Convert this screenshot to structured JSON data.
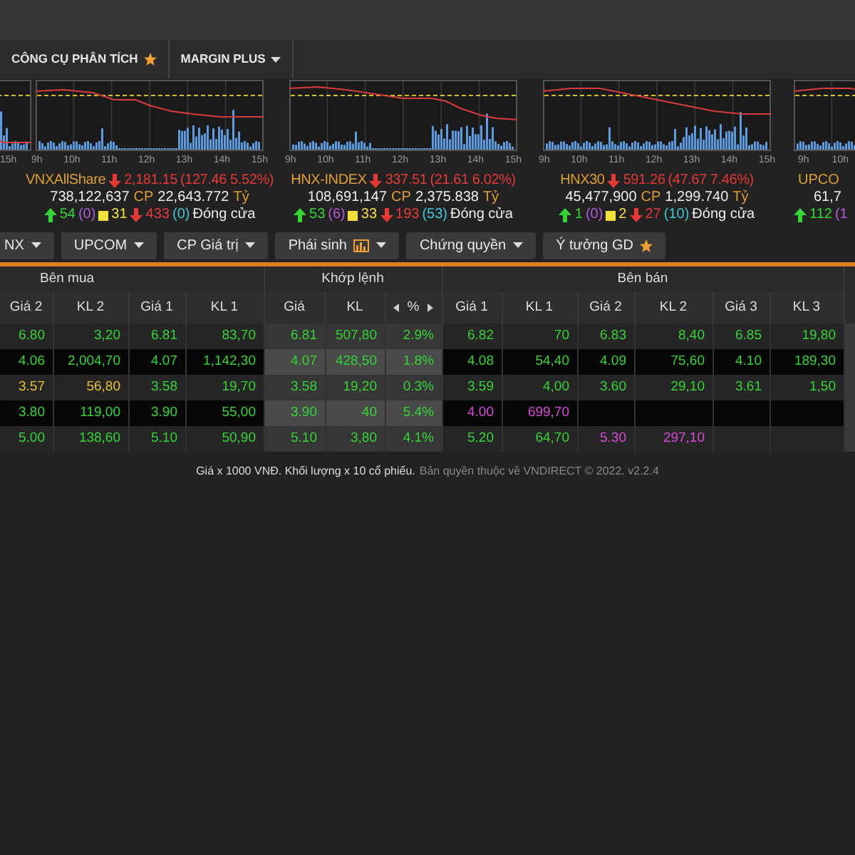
{
  "menu": [
    {
      "label": "CÔNG CỤ PHÂN TÍCH"
    },
    {
      "label": "MARGIN PLUS"
    }
  ],
  "indices": [
    {
      "kind": "partial-left",
      "x_labels": [
        "15h"
      ]
    },
    {
      "kind": "full",
      "x_labels": [
        "9h",
        "10h",
        "11h",
        "12h",
        "13h",
        "14h",
        "15h"
      ],
      "name": "VNXAllShare",
      "value": "2,181.15",
      "change": "(127.46 5.52%)",
      "volume": "738,122,637",
      "volume_unit": "CP",
      "turnover": "22,643.772",
      "turnover_unit": "Tỷ",
      "up": "54",
      "ceiling": "(0)",
      "flat": "31",
      "down": "433",
      "floor": "(0)",
      "status": "Đóng cửa"
    },
    {
      "kind": "full",
      "x_labels": [
        "9h",
        "10h",
        "11h",
        "12h",
        "13h",
        "14h",
        "15h"
      ],
      "name": "HNX-INDEX",
      "value": "337.51",
      "change": "(21.61 6.02%)",
      "volume": "108,691,147",
      "volume_unit": "CP",
      "turnover": "2,375.838",
      "turnover_unit": "Tỷ",
      "up": "53",
      "ceiling": "(6)",
      "flat": "33",
      "down": "193",
      "floor": "(53)",
      "status": "Đóng cửa"
    },
    {
      "kind": "full",
      "x_labels": [
        "9h",
        "10h",
        "11h",
        "12h",
        "13h",
        "14h",
        "15h"
      ],
      "name": "HNX30",
      "value": "591.26",
      "change": "(47.67 7.46%)",
      "volume": "45,477,900",
      "volume_unit": "CP",
      "turnover": "1,299.740",
      "turnover_unit": "Tỷ",
      "up": "1",
      "ceiling": "(0)",
      "flat": "2",
      "down": "27",
      "floor": "(10)",
      "status": "Đóng cửa"
    },
    {
      "kind": "partial-right",
      "x_labels": [
        "9h",
        "10h"
      ],
      "name": "UPCO",
      "volume": "61,7",
      "up": "112",
      "ceiling": "(1"
    }
  ],
  "tabs": [
    {
      "label": "NX"
    },
    {
      "label": "UPCOM"
    },
    {
      "label": "CP Giá trị"
    },
    {
      "label": "Phái sinh"
    },
    {
      "label": "Chứng quyền"
    },
    {
      "label": "Ý tưởng GD"
    }
  ],
  "table": {
    "groups": [
      {
        "label": "Bên mua",
        "columns": [
          "Giá 2",
          "KL 2",
          "Giá 1",
          "KL 1"
        ]
      },
      {
        "label": "Khớp lệnh",
        "columns": [
          "Giá",
          "KL",
          "%"
        ]
      },
      {
        "label": "Bên bán",
        "columns": [
          "Giá 1",
          "KL 1",
          "Giá 2",
          "KL 2",
          "Giá 3",
          "KL 3"
        ]
      }
    ],
    "rows": [
      {
        "cells": [
          {
            "text": "6.80",
            "color": "#33d633"
          },
          {
            "text": "3,20",
            "color": "#33d633"
          },
          {
            "text": "6.81",
            "color": "#33d633"
          },
          {
            "text": "83,70",
            "color": "#33d633"
          },
          {
            "text": "6.81",
            "color": "#33d633"
          },
          {
            "text": "507,80",
            "color": "#33d633"
          },
          {
            "text": "2.9%",
            "color": "#33d633"
          },
          {
            "text": "6.82",
            "color": "#33d633"
          },
          {
            "text": "70",
            "color": "#33d633"
          },
          {
            "text": "6.83",
            "color": "#33d633"
          },
          {
            "text": "8,40",
            "color": "#33d633"
          },
          {
            "text": "6.85",
            "color": "#33d633"
          },
          {
            "text": "19,80",
            "color": "#33d633"
          }
        ]
      },
      {
        "cells": [
          {
            "text": "4.06",
            "color": "#33d633"
          },
          {
            "text": "2,004,70",
            "color": "#33d633"
          },
          {
            "text": "4.07",
            "color": "#33d633"
          },
          {
            "text": "1,142,30",
            "color": "#33d633"
          },
          {
            "text": "4.07",
            "color": "#33d633"
          },
          {
            "text": "428,50",
            "color": "#33d633"
          },
          {
            "text": "1.8%",
            "color": "#33d633"
          },
          {
            "text": "4.08",
            "color": "#33d633"
          },
          {
            "text": "54,40",
            "color": "#33d633"
          },
          {
            "text": "4.09",
            "color": "#33d633"
          },
          {
            "text": "75,60",
            "color": "#33d633"
          },
          {
            "text": "4.10",
            "color": "#33d633"
          },
          {
            "text": "189,30",
            "color": "#33d633"
          }
        ]
      },
      {
        "cells": [
          {
            "text": "3.57",
            "color": "#e8c02a"
          },
          {
            "text": "56,80",
            "color": "#e8c02a"
          },
          {
            "text": "3.58",
            "color": "#33d633"
          },
          {
            "text": "19,70",
            "color": "#33d633"
          },
          {
            "text": "3.58",
            "color": "#33d633"
          },
          {
            "text": "19,20",
            "color": "#33d633"
          },
          {
            "text": "0.3%",
            "color": "#33d633"
          },
          {
            "text": "3.59",
            "color": "#33d633"
          },
          {
            "text": "4,00",
            "color": "#33d633"
          },
          {
            "text": "3.60",
            "color": "#33d633"
          },
          {
            "text": "29,10",
            "color": "#33d633"
          },
          {
            "text": "3.61",
            "color": "#33d633"
          },
          {
            "text": "1,50",
            "color": "#33d633"
          }
        ]
      },
      {
        "cells": [
          {
            "text": "3.80",
            "color": "#33d633"
          },
          {
            "text": "119,00",
            "color": "#33d633"
          },
          {
            "text": "3.90",
            "color": "#33d633"
          },
          {
            "text": "55,00",
            "color": "#33d633"
          },
          {
            "text": "3.90",
            "color": "#33d633"
          },
          {
            "text": "40",
            "color": "#33d633"
          },
          {
            "text": "5.4%",
            "color": "#33d633"
          },
          {
            "text": "4.00",
            "color": "#d94ad9"
          },
          {
            "text": "699,70",
            "color": "#d94ad9"
          }
        ]
      },
      {
        "cells": [
          {
            "text": "5.00",
            "color": "#33d633"
          },
          {
            "text": "138,60",
            "color": "#33d633"
          },
          {
            "text": "5.10",
            "color": "#33d633"
          },
          {
            "text": "50,90",
            "color": "#33d633"
          },
          {
            "text": "5.10",
            "color": "#33d633"
          },
          {
            "text": "3,80",
            "color": "#33d633"
          },
          {
            "text": "4.1%",
            "color": "#33d633"
          },
          {
            "text": "5.20",
            "color": "#33d633"
          },
          {
            "text": "64,70",
            "color": "#33d633"
          },
          {
            "text": "5.30",
            "color": "#d94ad9"
          },
          {
            "text": "297,10",
            "color": "#d94ad9"
          }
        ]
      }
    ]
  },
  "footer": {
    "note": "Giá x 1000 VNĐ. Khối lượng x 10 cổ phiếu.",
    "copyright": "Bản quyền thuộc về VNDIRECT © 2022. v2.2.4"
  }
}
